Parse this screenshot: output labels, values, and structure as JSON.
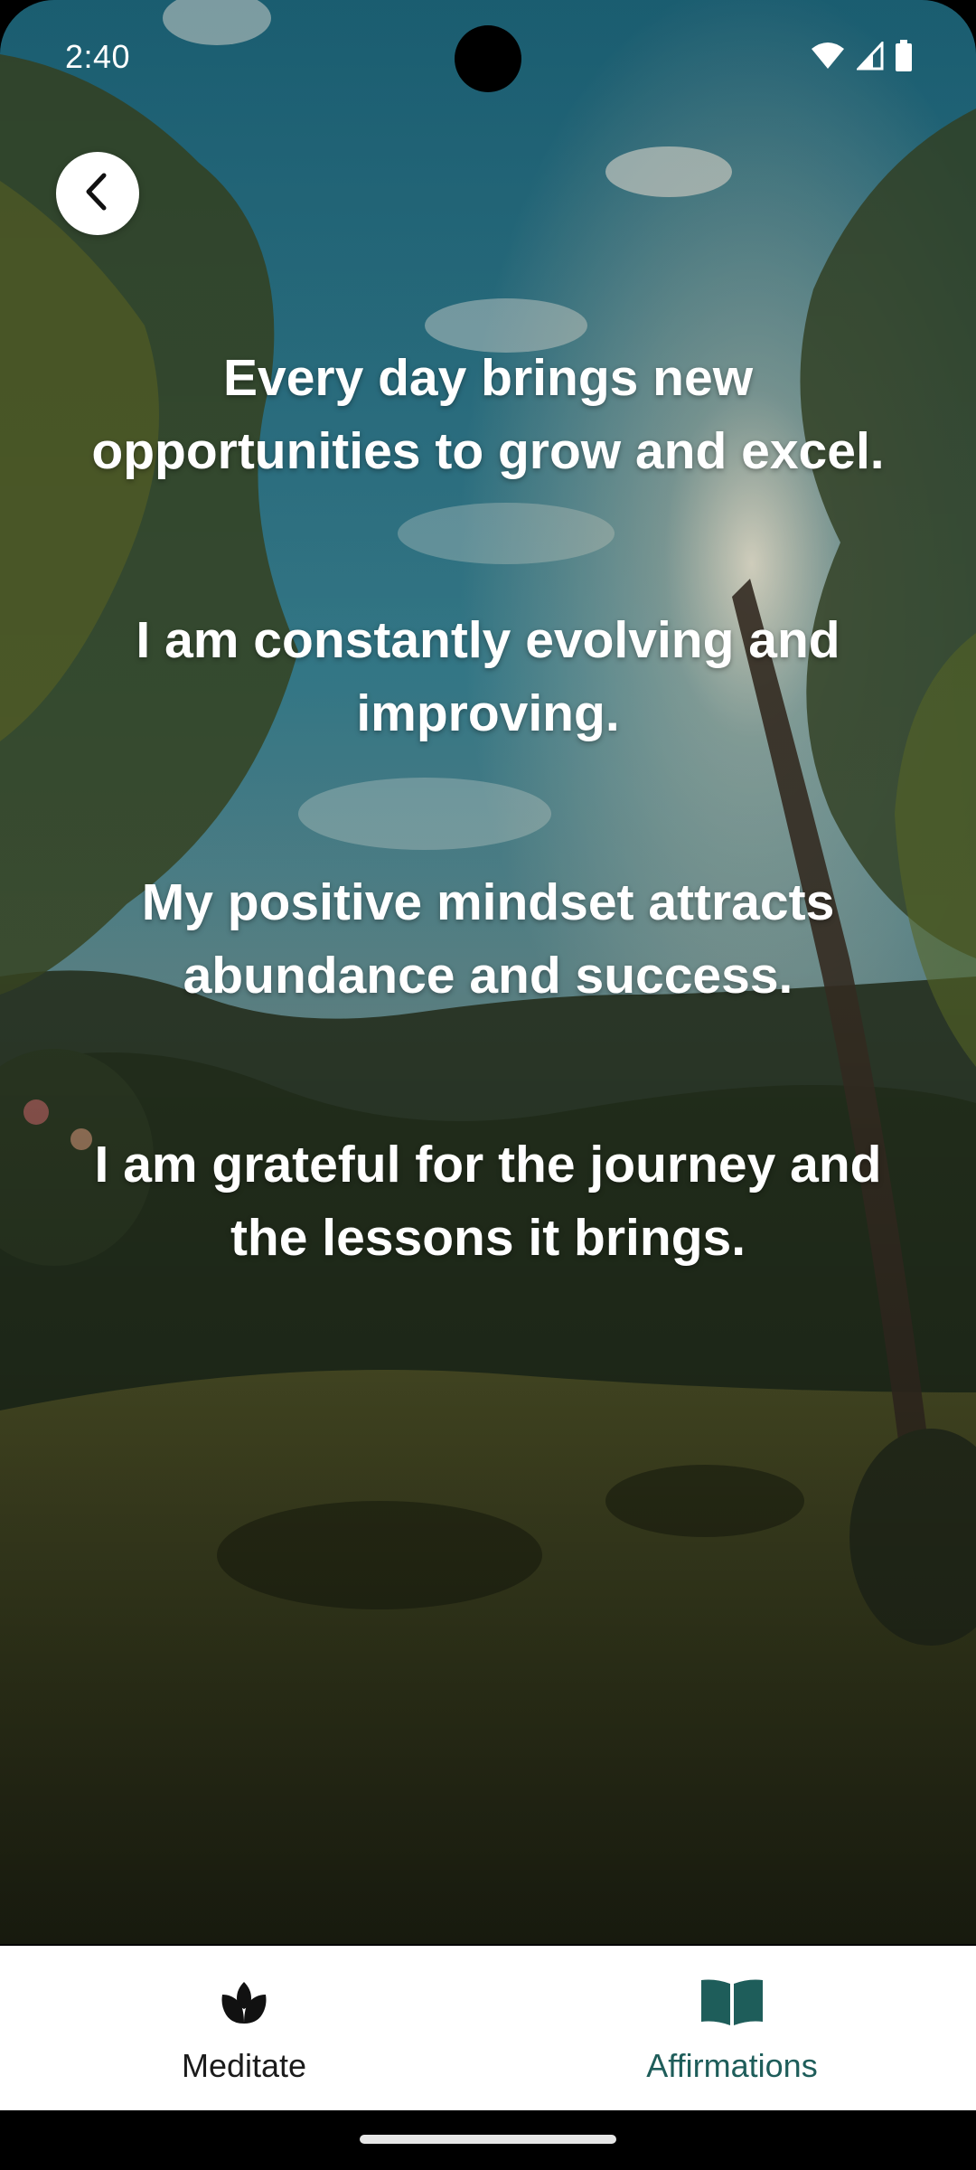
{
  "status_bar": {
    "time": "2:40",
    "icons": [
      "wifi-icon",
      "cellular-signal-icon",
      "battery-icon"
    ]
  },
  "header": {
    "back_icon": "chevron-left-icon"
  },
  "affirmations": [
    "Every day brings new opportunities to grow and excel.",
    "I am constantly evolving and improving.",
    "My positive mindset attracts abundance and success.",
    "I am grateful for the journey and the lessons it brings."
  ],
  "bottom_nav": {
    "items": [
      {
        "label": "Meditate",
        "icon": "lotus-icon",
        "active": false
      },
      {
        "label": "Affirmations",
        "icon": "open-book-icon",
        "active": true
      }
    ]
  },
  "colors": {
    "accent": "#1e5d5a",
    "nav_background": "#ffffff",
    "text_on_image": "#ffffff"
  }
}
